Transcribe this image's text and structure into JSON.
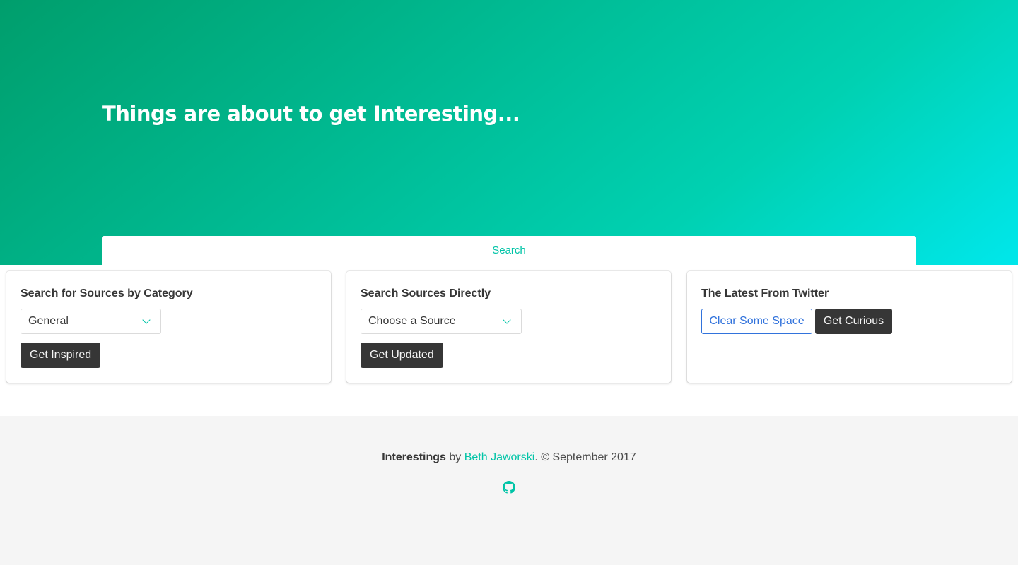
{
  "hero": {
    "title": "Things are about to get Interesting..."
  },
  "tabs": [
    {
      "label": "Search"
    }
  ],
  "cards": {
    "category": {
      "title": "Search for Sources by Category",
      "select_value": "General",
      "button_label": "Get Inspired"
    },
    "direct": {
      "title": "Search Sources Directly",
      "select_value": "Choose a Source",
      "button_label": "Get Updated"
    },
    "twitter": {
      "title": "The Latest From Twitter",
      "clear_label": "Clear Some Space",
      "curious_label": "Get Curious"
    }
  },
  "footer": {
    "brand": "Interestings",
    "by": " by ",
    "author": "Beth Jaworski",
    "copyright": ". © September 2017",
    "github_icon": "github-icon"
  },
  "colors": {
    "accent": "#00c4a7",
    "link_blue": "#3273dc",
    "dark_button": "#363636",
    "footer_bg": "#f5f5f5"
  }
}
